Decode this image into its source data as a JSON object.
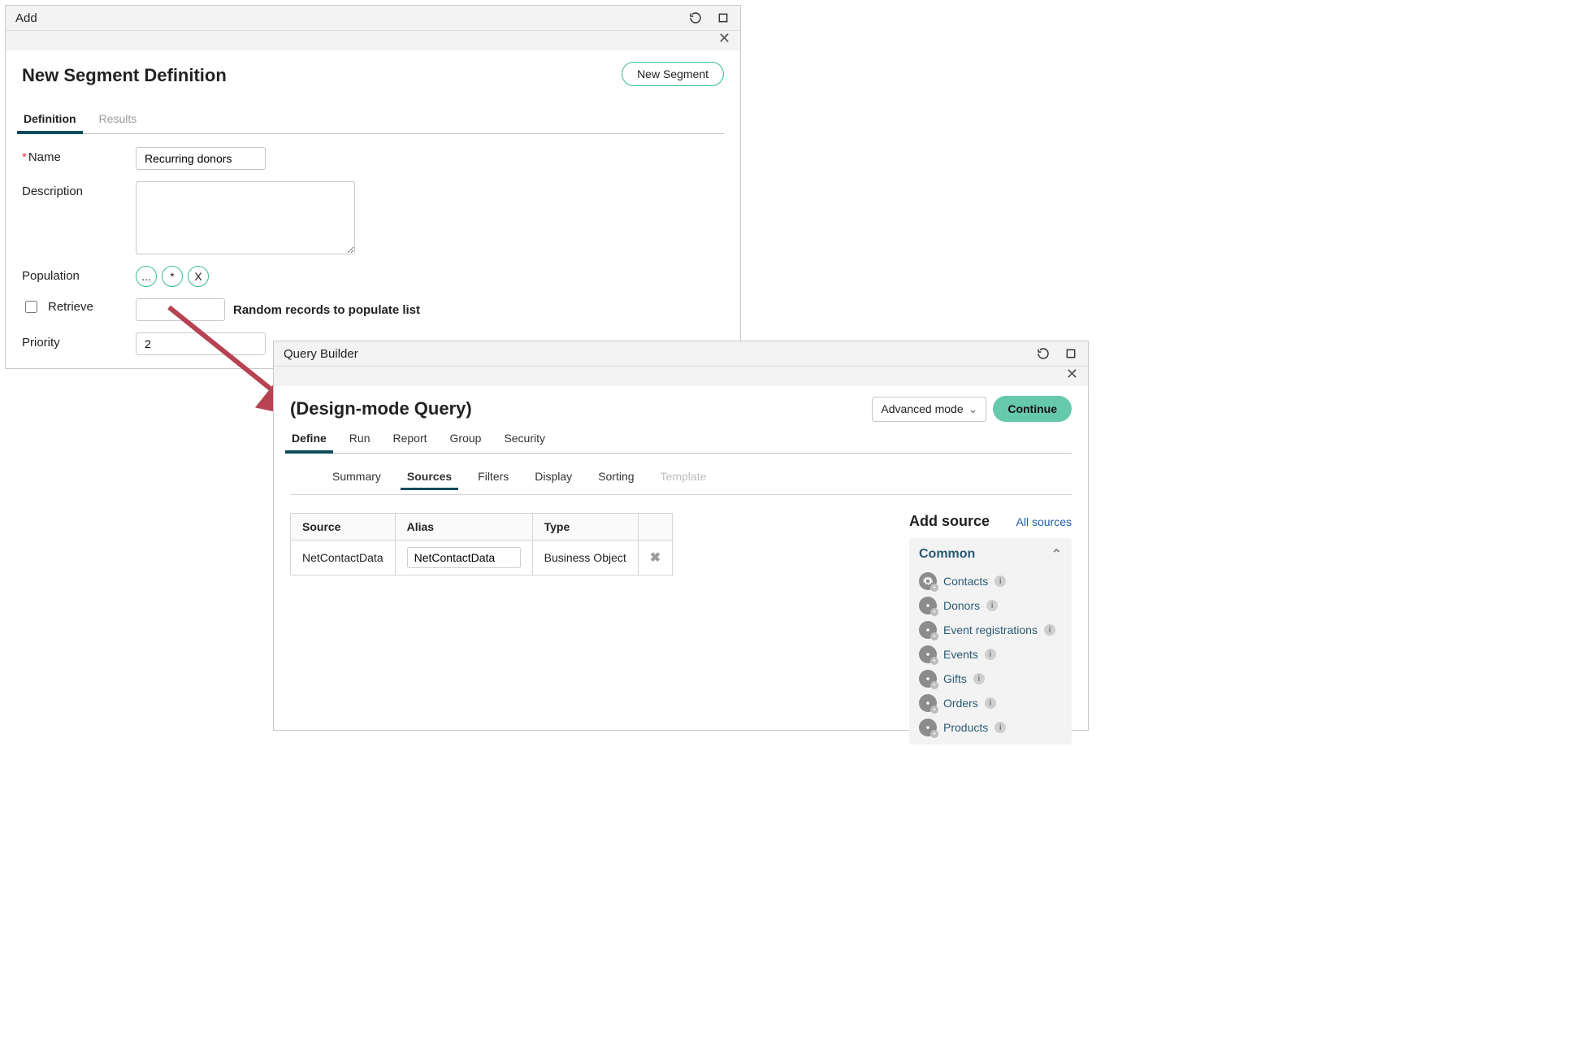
{
  "win_add": {
    "title": "Add",
    "page_title": "New Segment Definition",
    "new_segment_btn": "New Segment",
    "tabs": {
      "definition": "Definition",
      "results": "Results"
    },
    "form": {
      "name_label": "Name",
      "name_value": "Recurring donors",
      "description_label": "Description",
      "description_value": "",
      "population_label": "Population",
      "pop_btn_browse": "...",
      "pop_btn_wildcard": "*",
      "pop_btn_clear": "X",
      "retrieve_label": "Retrieve",
      "retrieve_checked": false,
      "retrieve_count": "",
      "retrieve_after": "Random records to populate list",
      "priority_label": "Priority",
      "priority_value": "2"
    }
  },
  "win_qb": {
    "title": "Query Builder",
    "page_title": "(Design-mode Query)",
    "mode_selected": "Advanced mode",
    "continue_btn": "Continue",
    "tabs": {
      "define": "Define",
      "run": "Run",
      "report": "Report",
      "group": "Group",
      "security": "Security"
    },
    "subtabs": {
      "summary": "Summary",
      "sources": "Sources",
      "filters": "Filters",
      "display": "Display",
      "sorting": "Sorting",
      "template": "Template"
    },
    "src_table": {
      "cols": {
        "source": "Source",
        "alias": "Alias",
        "type": "Type"
      },
      "row": {
        "source": "NetContactData",
        "alias": "NetContactData",
        "type": "Business Object"
      }
    },
    "side": {
      "head": "Add source",
      "all": "All sources",
      "group_title": "Common",
      "items": [
        "Contacts",
        "Donors",
        "Event registrations",
        "Events",
        "Gifts",
        "Orders",
        "Products"
      ]
    }
  }
}
